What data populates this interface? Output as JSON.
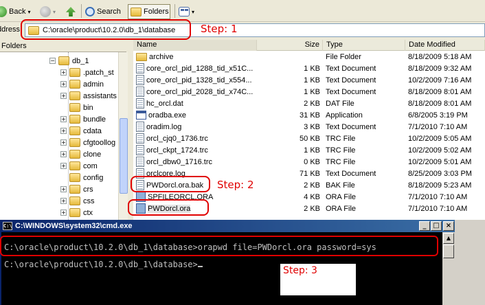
{
  "toolbar": {
    "back_label": "Back",
    "search_label": "Search",
    "folders_label": "Folders"
  },
  "address": {
    "label": "ddress",
    "path": "C:\\oracle\\product\\10.2.0\\db_1\\database"
  },
  "tree": {
    "header": "Folders",
    "root": "db_1",
    "items": [
      {
        "label": ".patch_st",
        "expandable": true
      },
      {
        "label": "admin",
        "expandable": true
      },
      {
        "label": "assistants",
        "expandable": true
      },
      {
        "label": "bin",
        "expandable": false
      },
      {
        "label": "bundle",
        "expandable": true
      },
      {
        "label": "cdata",
        "expandable": true
      },
      {
        "label": "cfgtoollog",
        "expandable": true
      },
      {
        "label": "clone",
        "expandable": true
      },
      {
        "label": "com",
        "expandable": true
      },
      {
        "label": "config",
        "expandable": false
      },
      {
        "label": "crs",
        "expandable": true
      },
      {
        "label": "css",
        "expandable": true
      },
      {
        "label": "ctx",
        "expandable": true
      }
    ]
  },
  "list": {
    "columns": [
      "Name",
      "Size",
      "Type",
      "Date Modified"
    ],
    "rows": [
      {
        "icon": "folder",
        "name": "archive",
        "size": "",
        "type": "File Folder",
        "date": "8/18/2009 5:18 AM"
      },
      {
        "icon": "doc",
        "name": "core_orcl_pid_1288_tid_x51C...",
        "size": "1 KB",
        "type": "Text Document",
        "date": "8/18/2009 9:32 AM"
      },
      {
        "icon": "doc",
        "name": "core_orcl_pid_1328_tid_x554...",
        "size": "1 KB",
        "type": "Text Document",
        "date": "10/2/2009 7:16 AM"
      },
      {
        "icon": "doc",
        "name": "core_orcl_pid_2028_tid_x74C...",
        "size": "1 KB",
        "type": "Text Document",
        "date": "8/18/2009 8:01 AM"
      },
      {
        "icon": "doc",
        "name": "hc_orcl.dat",
        "size": "2 KB",
        "type": "DAT File",
        "date": "8/18/2009 8:01 AM"
      },
      {
        "icon": "app",
        "name": "oradba.exe",
        "size": "31 KB",
        "type": "Application",
        "date": "6/8/2005 3:19 PM"
      },
      {
        "icon": "doc",
        "name": "oradim.log",
        "size": "3 KB",
        "type": "Text Document",
        "date": "7/1/2010 7:10 AM"
      },
      {
        "icon": "doc",
        "name": "orcl_cjq0_1736.trc",
        "size": "50 KB",
        "type": "TRC File",
        "date": "10/2/2009 5:05 AM"
      },
      {
        "icon": "doc",
        "name": "orcl_ckpt_1724.trc",
        "size": "1 KB",
        "type": "TRC File",
        "date": "10/2/2009 5:02 AM"
      },
      {
        "icon": "doc",
        "name": "orcl_dbw0_1716.trc",
        "size": "0 KB",
        "type": "TRC File",
        "date": "10/2/2009 5:01 AM"
      },
      {
        "icon": "doc",
        "name": "orclcore.log",
        "size": "71 KB",
        "type": "Text Document",
        "date": "8/25/2009 3:03 PM"
      },
      {
        "icon": "doc",
        "name": "PWDorcl.ora.bak",
        "size": "2 KB",
        "type": "BAK File",
        "date": "8/18/2009 5:23 AM"
      },
      {
        "icon": "ora",
        "name": "SPFILEORCL.ORA",
        "size": "4 KB",
        "type": "ORA File",
        "date": "7/1/2010 7:10 AM"
      },
      {
        "icon": "ora",
        "name": "PWDorcl.ora",
        "size": "2 KB",
        "type": "ORA File",
        "date": "7/1/2010 7:10 AM"
      }
    ]
  },
  "steps": {
    "step1": "Step: 1",
    "step2": "Step: 2",
    "step3": "Step: 3"
  },
  "cmd": {
    "title": "C:\\WINDOWS\\system32\\cmd.exe",
    "line1": "C:\\oracle\\product\\10.2.0\\db_1\\database>orapwd file=PWDorcl.ora password=sys",
    "line2": "C:\\oracle\\product\\10.2.0\\db_1\\database>"
  },
  "colors": {
    "annotation": "#e00000",
    "titlebar": "#0a246a",
    "console_bg": "#000000",
    "console_fg": "#c0c0c0"
  }
}
